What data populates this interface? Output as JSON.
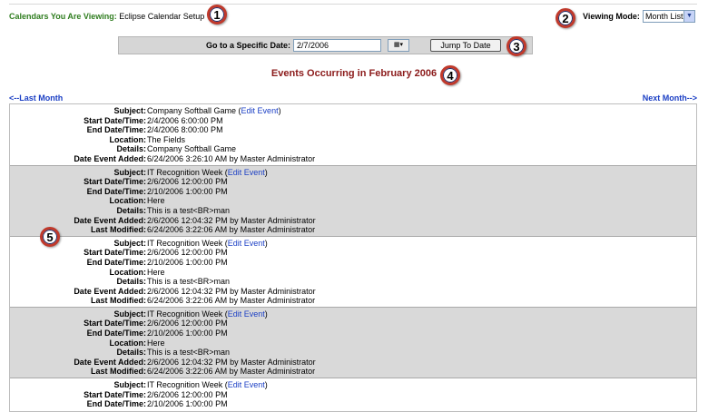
{
  "header": {
    "calendars_label": "Calendars You Are Viewing:",
    "calendar_name": "Eclipse Calendar Setup",
    "viewing_mode_label": "Viewing Mode:",
    "viewing_mode_value": "Month List"
  },
  "goto": {
    "label": "Go to a Specific Date:",
    "date_value": "2/7/2006",
    "jump_label": "Jump To Date"
  },
  "events_title": "Events Occurring in February 2006",
  "nav": {
    "prev": "<--Last Month",
    "next": "Next Month-->"
  },
  "callouts": [
    "1",
    "2",
    "3",
    "4",
    "5"
  ],
  "labels": {
    "subject": "Subject:",
    "start": "Start Date/Time:",
    "end": "End Date/Time:",
    "location": "Location:",
    "details": "Details:",
    "added": "Date Event Added:",
    "modified": "Last Modified:",
    "edit_link": "Edit Event"
  },
  "events": [
    {
      "subject": "Company Softball Game",
      "start": "2/4/2006 6:00:00 PM",
      "end": "2/4/2006 8:00:00 PM",
      "location": "The Fields",
      "details": "Company Softball Game",
      "added": "6/24/2006 3:26:10 AM by Master Administrator",
      "modified": ""
    },
    {
      "subject": "IT Recognition Week",
      "start": "2/6/2006 12:00:00 PM",
      "end": "2/10/2006 1:00:00 PM",
      "location": "Here",
      "details": "This is a test<BR>man",
      "added": "2/6/2006 12:04:32 PM by Master Administrator",
      "modified": "6/24/2006 3:22:06 AM by Master Administrator"
    },
    {
      "subject": "IT Recognition Week",
      "start": "2/6/2006 12:00:00 PM",
      "end": "2/10/2006 1:00:00 PM",
      "location": "Here",
      "details": "This is a test<BR>man",
      "added": "2/6/2006 12:04:32 PM by Master Administrator",
      "modified": "6/24/2006 3:22:06 AM by Master Administrator"
    },
    {
      "subject": "IT Recognition Week",
      "start": "2/6/2006 12:00:00 PM",
      "end": "2/10/2006 1:00:00 PM",
      "location": "Here",
      "details": "This is a test<BR>man",
      "added": "2/6/2006 12:04:32 PM by Master Administrator",
      "modified": "6/24/2006 3:22:06 AM by Master Administrator"
    },
    {
      "subject": "IT Recognition Week",
      "start": "2/6/2006 12:00:00 PM",
      "end": "2/10/2006 1:00:00 PM",
      "location": "",
      "details": "",
      "added": "",
      "modified": ""
    }
  ]
}
